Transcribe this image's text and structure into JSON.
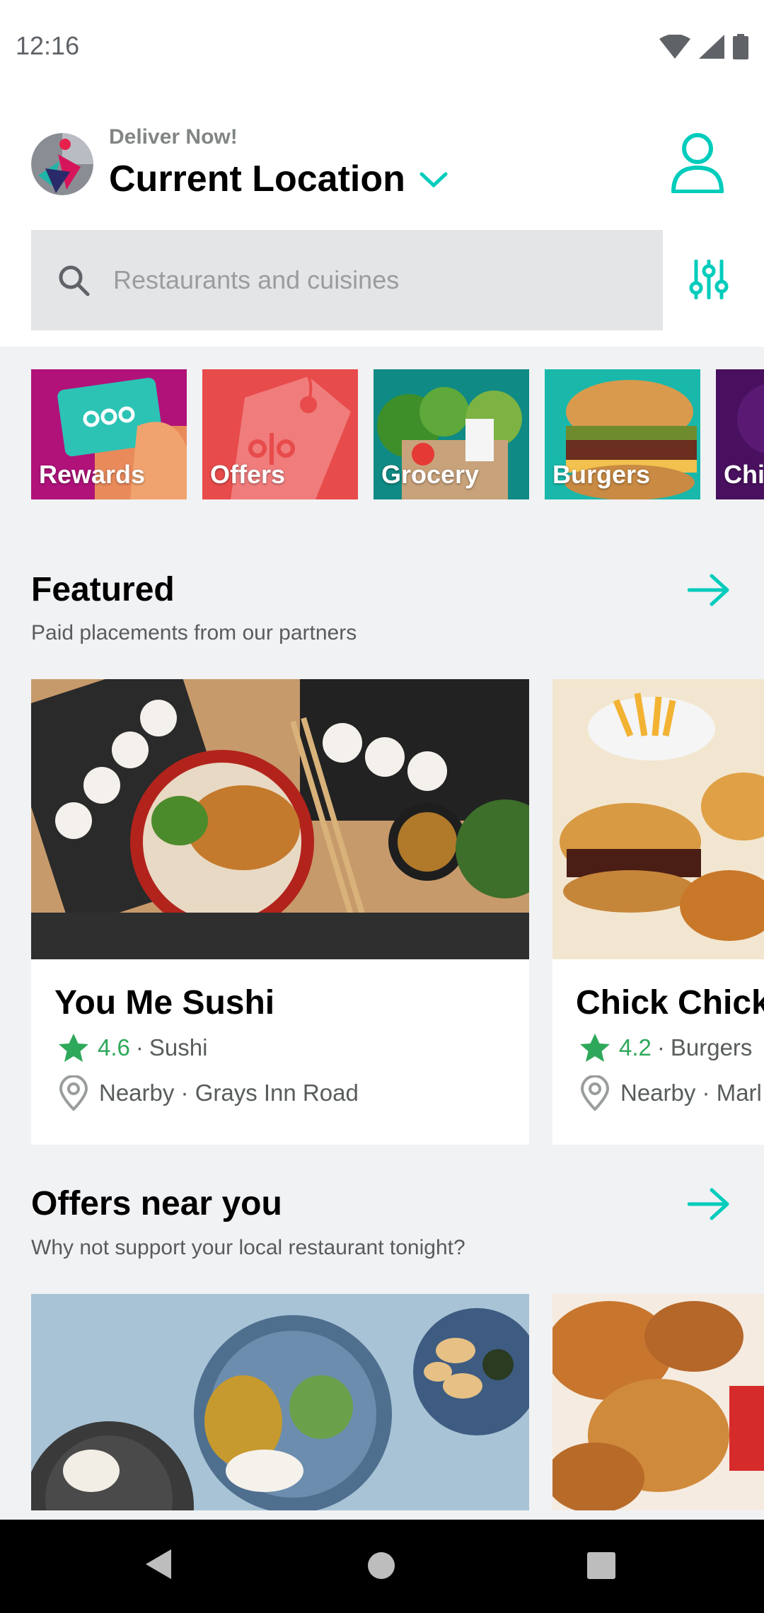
{
  "status_bar": {
    "time": "12:16"
  },
  "header": {
    "deliver_label": "Deliver Now!",
    "location": "Current Location"
  },
  "search": {
    "placeholder": "Restaurants and cuisines"
  },
  "categories": [
    "Rewards",
    "Offers",
    "Grocery",
    "Burgers",
    "Chi"
  ],
  "featured": {
    "title": "Featured",
    "subtitle": "Paid placements from our partners",
    "cards": [
      {
        "name": "You Me Sushi",
        "rating": "4.6",
        "cuisine": "Sushi",
        "location": "Nearby · Grays Inn Road"
      },
      {
        "name": "Chick Chick",
        "rating": "4.2",
        "cuisine": "Burgers",
        "location": "Nearby · Marl"
      }
    ]
  },
  "offers": {
    "title": "Offers near you",
    "subtitle": "Why not support your local restaurant tonight?"
  },
  "colors": {
    "teal": "#00CCBC",
    "rating_green": "#2EA85A",
    "rewards_bg": "#B0127A",
    "offers_bg": "#E84B4B"
  },
  "icons": [
    "wifi-icon",
    "signal-icon",
    "battery-icon",
    "search-icon",
    "filter-icon",
    "account-icon",
    "arrow-right-icon",
    "star-icon",
    "location-pin-icon"
  ]
}
